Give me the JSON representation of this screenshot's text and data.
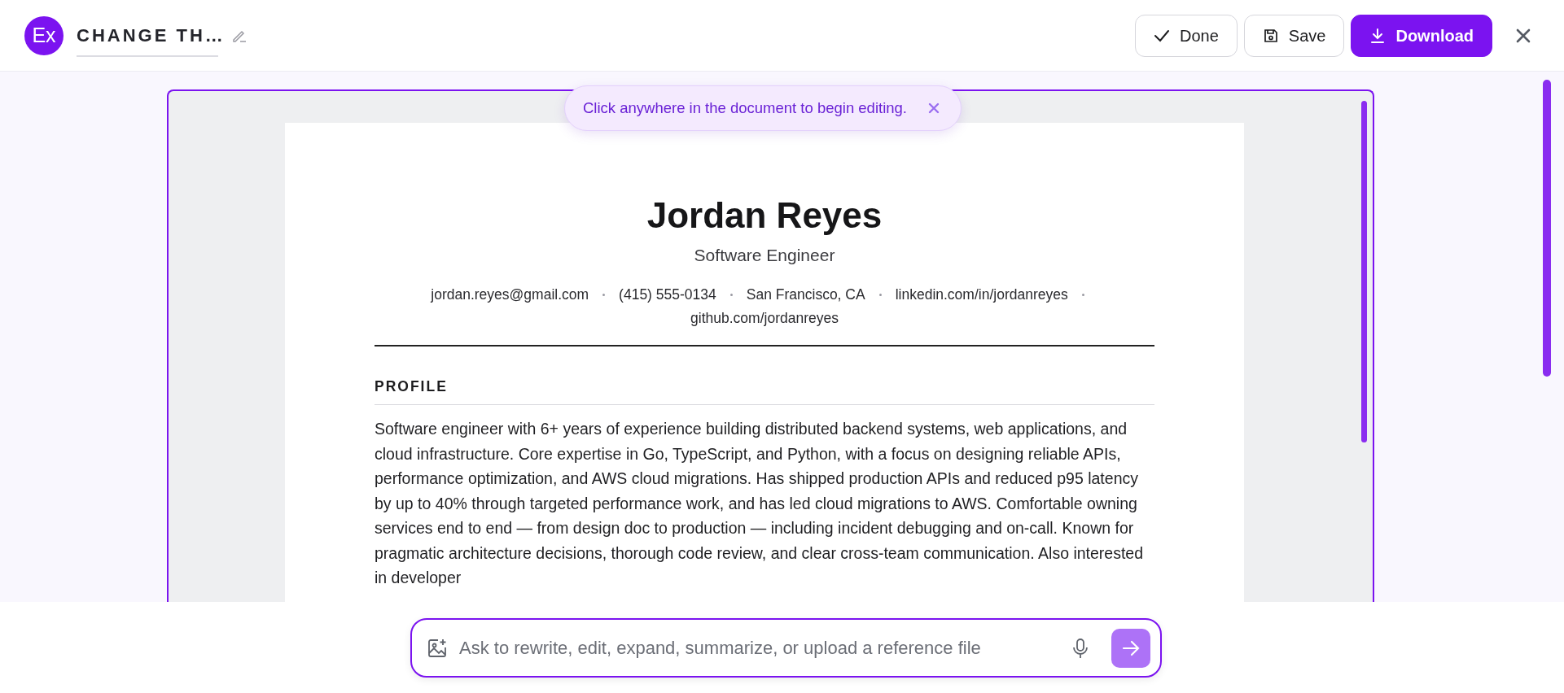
{
  "app": {
    "logo": "Ex",
    "title": "CHANGE TH…"
  },
  "actions": [
    {
      "kind": "done",
      "label": "Done"
    },
    {
      "kind": "save",
      "label": "Save"
    },
    {
      "kind": "download",
      "label": "Download"
    }
  ],
  "toast": {
    "message": "Click anywhere in the document to begin editing."
  },
  "resume": {
    "name": "Jordan Reyes",
    "title": "Software Engineer",
    "contacts": [
      "jordan.reyes@gmail.com",
      "(415) 555-0134",
      "San Francisco, CA",
      "linkedin.com/in/jordanreyes",
      "github.com/jordanreyes"
    ],
    "sections": [
      {
        "heading": "PROFILE",
        "paragraph": "Software engineer with 6+ years of experience building distributed backend systems, web applications, and cloud infrastructure. Core expertise in Go, TypeScript, and Python, with a focus on designing reliable APIs, performance optimization, and AWS cloud migrations. Has shipped production APIs and reduced p95 latency by up to 40% through targeted performance work, and has led cloud migrations to AWS. Comfortable owning services end to end — from design doc to production — including incident debugging and on-call. Known for pragmatic architecture decisions, thorough code review, and clear cross-team communication. Also interested in developer"
      }
    ]
  },
  "composer": {
    "placeholder": "Ask to rewrite, edit, expand, summarize, or upload a reference file"
  }
}
